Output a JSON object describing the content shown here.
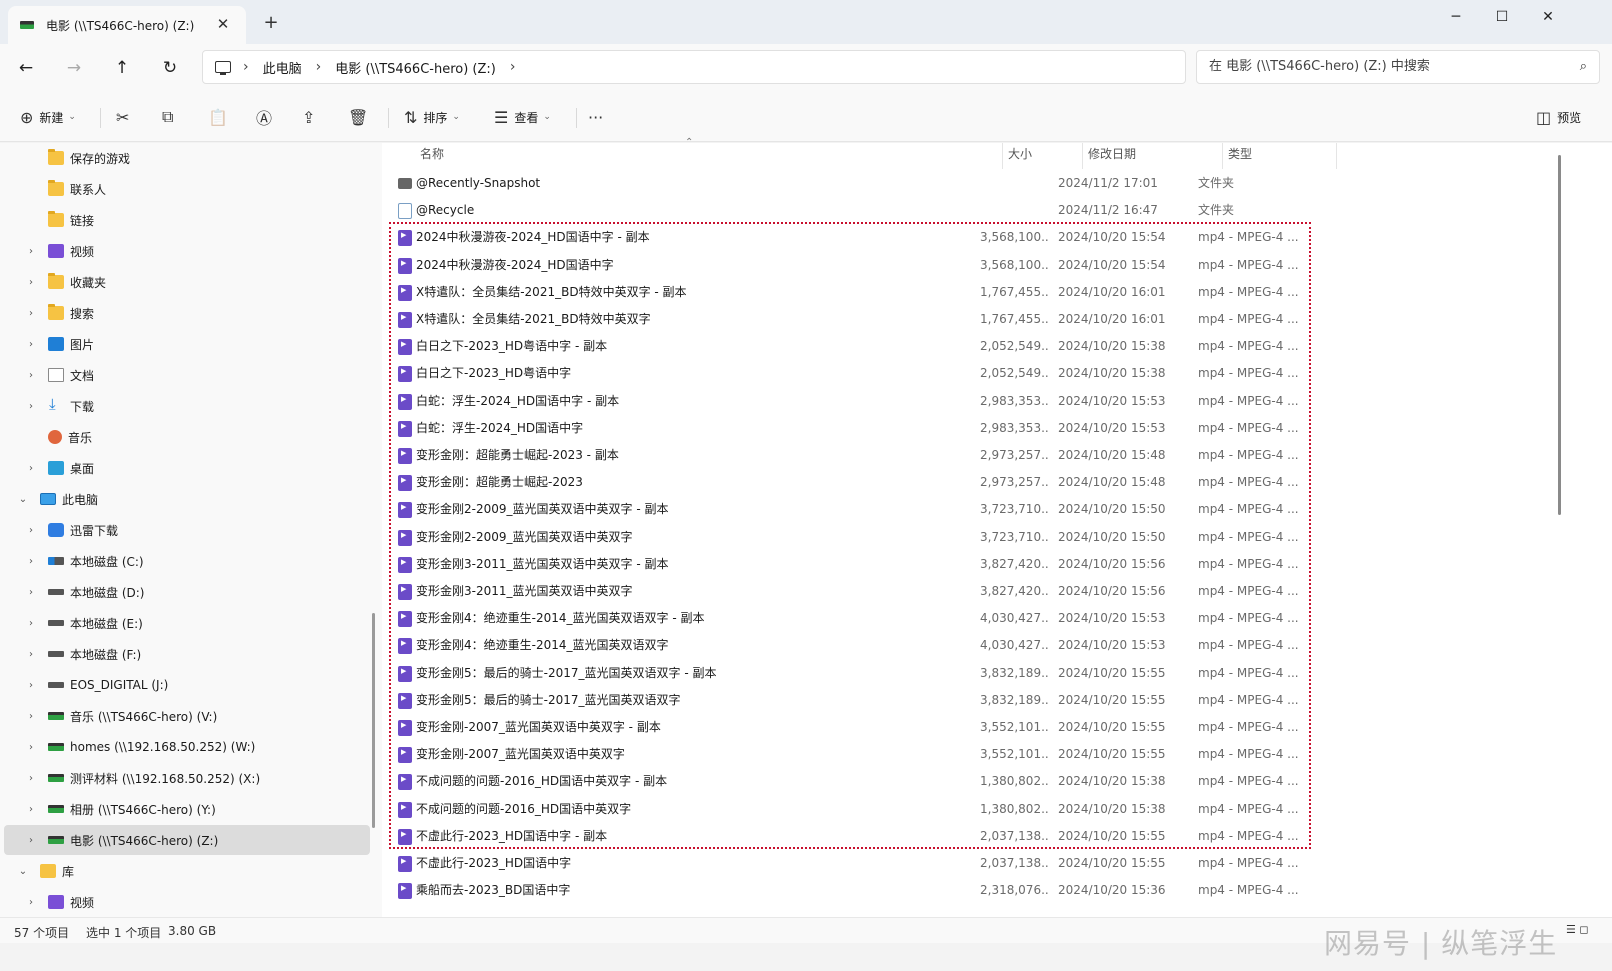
{
  "window": {
    "tab_title": "电影 (\\\\TS466C-hero) (Z:)",
    "tab_close": "✕",
    "new_tab": "+",
    "minimize": "─",
    "maximize": "☐",
    "close": "✕"
  },
  "address": {
    "back": "←",
    "forward": "→",
    "up": "↑",
    "refresh": "↻",
    "sep": "›",
    "crumbs": [
      "此电脑",
      "电影 (\\\\TS466C-hero) (Z:)"
    ],
    "search_placeholder": "在 电影 (\\\\TS466C-hero) (Z:) 中搜索",
    "search_icon": "⌕"
  },
  "toolbar": {
    "new_icon": "⊕",
    "new_label": "新建",
    "caret": "⌄",
    "cut": "✂",
    "copy": "⧉",
    "paste": "📋",
    "rename": "Ⓐ",
    "share": "⇪",
    "delete": "🗑",
    "sort_icon": "⇅",
    "sort_label": "排序",
    "view_icon": "☰",
    "view_label": "查看",
    "more": "···",
    "preview_icon": "◫",
    "preview_label": "预览"
  },
  "sidebar": {
    "expand": "›",
    "collapse": "⌄",
    "items": [
      {
        "label": "保存的游戏",
        "icon": "folder"
      },
      {
        "label": "联系人",
        "icon": "folder"
      },
      {
        "label": "链接",
        "icon": "folder"
      },
      {
        "label": "视频",
        "icon": "video"
      },
      {
        "label": "收藏夹",
        "icon": "folder"
      },
      {
        "label": "搜索",
        "icon": "folder"
      },
      {
        "label": "图片",
        "icon": "pictures"
      },
      {
        "label": "文档",
        "icon": "docs"
      },
      {
        "label": "下载",
        "icon": "download"
      },
      {
        "label": "音乐",
        "icon": "music"
      },
      {
        "label": "桌面",
        "icon": "desktop"
      },
      {
        "label": "此电脑",
        "icon": "pc"
      },
      {
        "label": "迅雷下载",
        "icon": "xunlei"
      },
      {
        "label": "本地磁盘 (C:)",
        "icon": "drive-c"
      },
      {
        "label": "本地磁盘 (D:)",
        "icon": "drive"
      },
      {
        "label": "本地磁盘 (E:)",
        "icon": "drive"
      },
      {
        "label": "本地磁盘 (F:)",
        "icon": "drive"
      },
      {
        "label": "EOS_DIGITAL (J:)",
        "icon": "drive"
      },
      {
        "label": "音乐 (\\\\TS466C-hero) (V:)",
        "icon": "net"
      },
      {
        "label": "homes (\\\\192.168.50.252) (W:)",
        "icon": "net"
      },
      {
        "label": "测评材料 (\\\\192.168.50.252) (X:)",
        "icon": "net"
      },
      {
        "label": "相册 (\\\\TS466C-hero) (Y:)",
        "icon": "net"
      },
      {
        "label": "电影 (\\\\TS466C-hero) (Z:)",
        "icon": "net"
      },
      {
        "label": "库",
        "icon": "lib"
      },
      {
        "label": "视频",
        "icon": "video"
      }
    ]
  },
  "columns": {
    "name": "名称",
    "size": "大小",
    "date": "修改日期",
    "type": "类型",
    "sort_caret": "⌃"
  },
  "files": [
    {
      "name": "@Recently-Snapshot",
      "size": "",
      "date": "2024/11/2 17:01",
      "type": "文件夹",
      "icon": "snapshot"
    },
    {
      "name": "@Recycle",
      "size": "",
      "date": "2024/11/2 16:47",
      "type": "文件夹",
      "icon": "recycle"
    },
    {
      "name": "2024中秋漫游夜-2024_HD国语中字 - 副本",
      "size": "3,568,100...",
      "date": "2024/10/20 15:54",
      "type": "mp4 - MPEG-4 ...",
      "icon": "mp4"
    },
    {
      "name": "2024中秋漫游夜-2024_HD国语中字",
      "size": "3,568,100...",
      "date": "2024/10/20 15:54",
      "type": "mp4 - MPEG-4 ...",
      "icon": "mp4"
    },
    {
      "name": "X特遣队：全员集结-2021_BD特效中英双字 - 副本",
      "size": "1,767,455...",
      "date": "2024/10/20 16:01",
      "type": "mp4 - MPEG-4 ...",
      "icon": "mp4"
    },
    {
      "name": "X特遣队：全员集结-2021_BD特效中英双字",
      "size": "1,767,455...",
      "date": "2024/10/20 16:01",
      "type": "mp4 - MPEG-4 ...",
      "icon": "mp4"
    },
    {
      "name": "白日之下-2023_HD粤语中字 - 副本",
      "size": "2,052,549...",
      "date": "2024/10/20 15:38",
      "type": "mp4 - MPEG-4 ...",
      "icon": "mp4"
    },
    {
      "name": "白日之下-2023_HD粤语中字",
      "size": "2,052,549...",
      "date": "2024/10/20 15:38",
      "type": "mp4 - MPEG-4 ...",
      "icon": "mp4"
    },
    {
      "name": "白蛇：浮生-2024_HD国语中字 - 副本",
      "size": "2,983,353...",
      "date": "2024/10/20 15:53",
      "type": "mp4 - MPEG-4 ...",
      "icon": "mp4"
    },
    {
      "name": "白蛇：浮生-2024_HD国语中字",
      "size": "2,983,353...",
      "date": "2024/10/20 15:53",
      "type": "mp4 - MPEG-4 ...",
      "icon": "mp4"
    },
    {
      "name": "变形金刚：超能勇士崛起-2023 - 副本",
      "size": "2,973,257...",
      "date": "2024/10/20 15:48",
      "type": "mp4 - MPEG-4 ...",
      "icon": "mp4"
    },
    {
      "name": "变形金刚：超能勇士崛起-2023",
      "size": "2,973,257...",
      "date": "2024/10/20 15:48",
      "type": "mp4 - MPEG-4 ...",
      "icon": "mp4"
    },
    {
      "name": "变形金刚2-2009_蓝光国英双语中英双字 - 副本",
      "size": "3,723,710...",
      "date": "2024/10/20 15:50",
      "type": "mp4 - MPEG-4 ...",
      "icon": "mp4"
    },
    {
      "name": "变形金刚2-2009_蓝光国英双语中英双字",
      "size": "3,723,710...",
      "date": "2024/10/20 15:50",
      "type": "mp4 - MPEG-4 ...",
      "icon": "mp4"
    },
    {
      "name": "变形金刚3-2011_蓝光国英双语中英双字 - 副本",
      "size": "3,827,420...",
      "date": "2024/10/20 15:56",
      "type": "mp4 - MPEG-4 ...",
      "icon": "mp4"
    },
    {
      "name": "变形金刚3-2011_蓝光国英双语中英双字",
      "size": "3,827,420...",
      "date": "2024/10/20 15:56",
      "type": "mp4 - MPEG-4 ...",
      "icon": "mp4"
    },
    {
      "name": "变形金刚4：绝迹重生-2014_蓝光国英双语双字 - 副本",
      "size": "4,030,427...",
      "date": "2024/10/20 15:53",
      "type": "mp4 - MPEG-4 ...",
      "icon": "mp4"
    },
    {
      "name": "变形金刚4：绝迹重生-2014_蓝光国英双语双字",
      "size": "4,030,427...",
      "date": "2024/10/20 15:53",
      "type": "mp4 - MPEG-4 ...",
      "icon": "mp4"
    },
    {
      "name": "变形金刚5：最后的骑士-2017_蓝光国英双语双字 - 副本",
      "size": "3,832,189...",
      "date": "2024/10/20 15:55",
      "type": "mp4 - MPEG-4 ...",
      "icon": "mp4"
    },
    {
      "name": "变形金刚5：最后的骑士-2017_蓝光国英双语双字",
      "size": "3,832,189...",
      "date": "2024/10/20 15:55",
      "type": "mp4 - MPEG-4 ...",
      "icon": "mp4"
    },
    {
      "name": "变形金刚-2007_蓝光国英双语中英双字 - 副本",
      "size": "3,552,101...",
      "date": "2024/10/20 15:55",
      "type": "mp4 - MPEG-4 ...",
      "icon": "mp4"
    },
    {
      "name": "变形金刚-2007_蓝光国英双语中英双字",
      "size": "3,552,101...",
      "date": "2024/10/20 15:55",
      "type": "mp4 - MPEG-4 ...",
      "icon": "mp4"
    },
    {
      "name": "不成问题的问题-2016_HD国语中英双字 - 副本",
      "size": "1,380,802...",
      "date": "2024/10/20 15:38",
      "type": "mp4 - MPEG-4 ...",
      "icon": "mp4"
    },
    {
      "name": "不成问题的问题-2016_HD国语中英双字",
      "size": "1,380,802...",
      "date": "2024/10/20 15:38",
      "type": "mp4 - MPEG-4 ...",
      "icon": "mp4"
    },
    {
      "name": "不虚此行-2023_HD国语中字 - 副本",
      "size": "2,037,138...",
      "date": "2024/10/20 15:55",
      "type": "mp4 - MPEG-4 ...",
      "icon": "mp4"
    },
    {
      "name": "不虚此行-2023_HD国语中字",
      "size": "2,037,138...",
      "date": "2024/10/20 15:55",
      "type": "mp4 - MPEG-4 ...",
      "icon": "mp4"
    },
    {
      "name": "乘船而去-2023_BD国语中字",
      "size": "2,318,076...",
      "date": "2024/10/20 15:36",
      "type": "mp4 - MPEG-4 ...",
      "icon": "mp4"
    }
  ],
  "status": {
    "count": "57 个项目",
    "selected": "选中 1 个项目",
    "size": "3.80 GB",
    "view_details": "☰",
    "view_tiles": "◻"
  },
  "watermark": "网易号 | 纵笔浮生"
}
